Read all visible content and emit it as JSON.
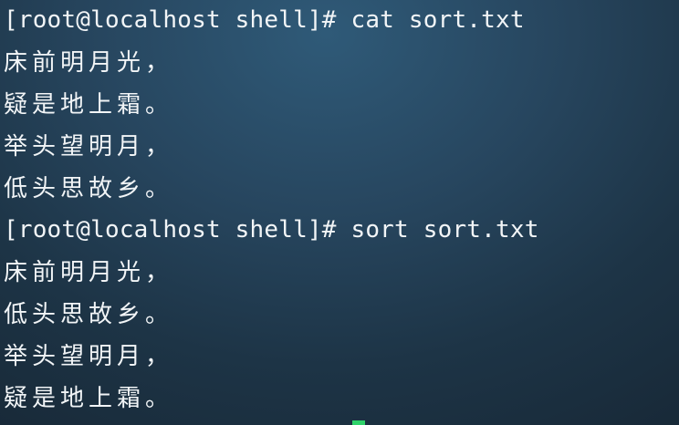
{
  "terminal": {
    "lines": [
      "[root@localhost shell]# cat sort.txt",
      "床前明月光，",
      "疑是地上霜。",
      "举头望明月，",
      "低头思故乡。",
      "[root@localhost shell]# sort sort.txt",
      "床前明月光，",
      "低头思故乡。",
      "举头望明月，",
      "疑是地上霜。"
    ],
    "cursor_color": "#2fd36a"
  }
}
